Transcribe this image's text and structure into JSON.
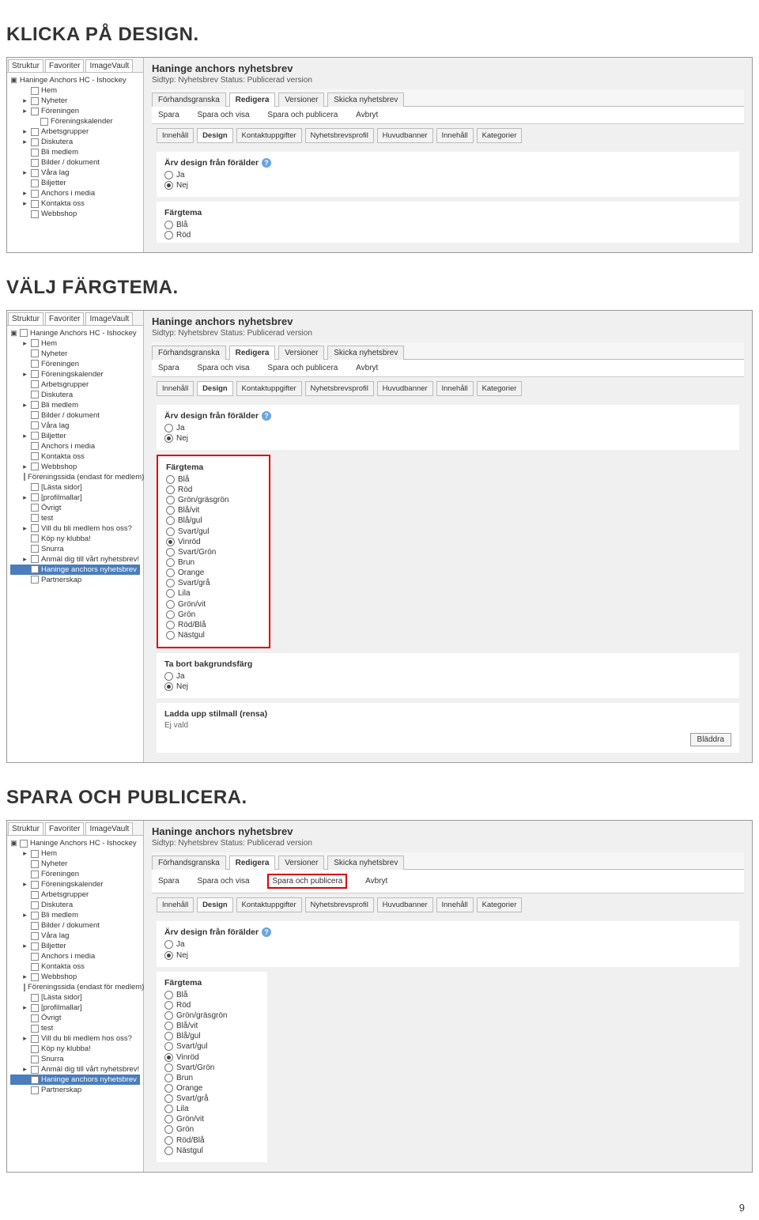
{
  "page_number": "9",
  "steps": {
    "s1": "KLICKA PÅ DESIGN.",
    "s2": "VÄLJ FÄRGTEMA.",
    "s3": "SPARA OCH PUBLICERA."
  },
  "sidebar": {
    "tabs": [
      "Struktur",
      "Favoriter",
      "ImageVault"
    ],
    "items_short": [
      "Haninge Anchors HC - Ishockey",
      "Hem",
      "Nyheter",
      "Föreningen",
      "Föreningskalender",
      "Arbetsgrupper",
      "Diskutera",
      "Bli medlem",
      "Bilder / dokument",
      "Våra lag",
      "Biljetter",
      "Anchors i media",
      "Kontakta oss",
      "Webbshop"
    ],
    "items_extra": [
      "Föreningssida (endast för medlem)",
      "[Lästa sidor]",
      "[profilmallar]",
      "Övrigt",
      "test",
      "Vill du bli medlem hos oss?",
      "Köp ny klubba!",
      "Snurra",
      "Anmäl dig till vårt nyhetsbrev!",
      "Haninge anchors nyhetsbrev",
      "Partnerskap"
    ]
  },
  "content": {
    "title": "Haninge anchors nyhetsbrev",
    "breadcrumb": "Sidtyp: Nyhetsbrev   Status: Publicerad version",
    "main_tabs": [
      "Förhandsgranska",
      "Redigera",
      "Versioner",
      "Skicka nyhetsbrev"
    ],
    "active_main_tab": "Redigera",
    "toolbar": [
      "Spara",
      "Spara och visa",
      "Spara och publicera",
      "Avbryt"
    ],
    "subtabs": [
      "Innehåll",
      "Design",
      "Kontaktuppgifter",
      "Nyhetsbrevsprofil",
      "Huvudbanner",
      "Innehåll",
      "Kategorier"
    ],
    "active_subtab": "Design",
    "inherit": {
      "title": "Ärv design från förälder",
      "opts": [
        "Ja",
        "Nej"
      ],
      "selected": "Nej"
    },
    "fargtema": {
      "title": "Färgtema",
      "short": [
        "Blå",
        "Röd"
      ],
      "full": [
        "Blå",
        "Röd",
        "Grön/gräsgrön",
        "Blå/vit",
        "Blå/gul",
        "Svart/gul",
        "Vinröd",
        "Svart/Grön",
        "Brun",
        "Orange",
        "Svart/grå",
        "Lila",
        "Grön/vit",
        "Grön",
        "Röd/Blå",
        "Nästgul"
      ],
      "selected": "Vinröd"
    },
    "bgcolor": {
      "title": "Ta bort bakgrundsfärg",
      "opts": [
        "Ja",
        "Nej"
      ],
      "selected": "Nej"
    },
    "upload": {
      "title": "Ladda upp stilmall (rensa)",
      "rensa": "rensa",
      "none": "Ej vald",
      "button": "Bläddra"
    }
  }
}
